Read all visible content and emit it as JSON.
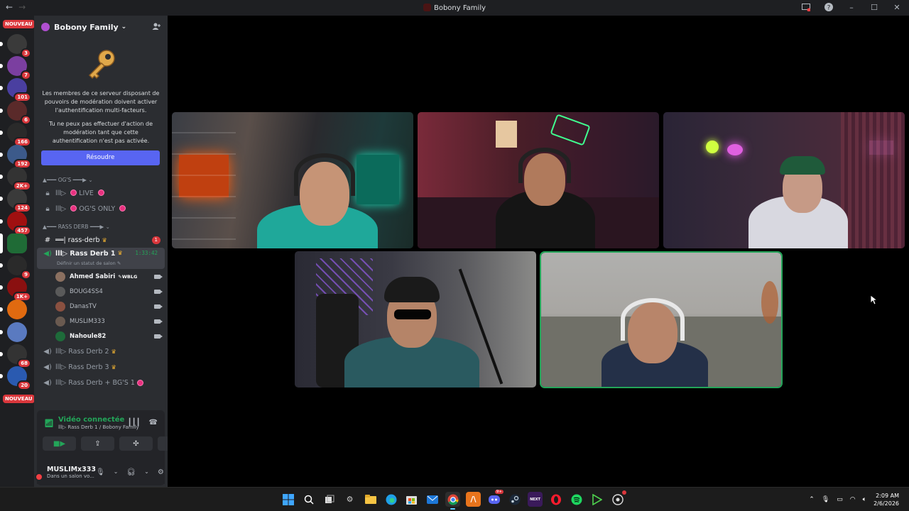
{
  "window": {
    "title": "Bobony Family"
  },
  "rail": {
    "nouveau_label": "NOUVEAU",
    "servers": [
      {
        "badge": "3",
        "color": "#3a3a3a"
      },
      {
        "badge": "7",
        "color": "#7b3fa0"
      },
      {
        "badge": "101",
        "color": "#4a3fa0"
      },
      {
        "badge": "6",
        "color": "#5a2a2a"
      },
      {
        "badge": "166",
        "color": "#2a2a2a"
      },
      {
        "badge": "192",
        "color": "#3c5a8a"
      },
      {
        "badge": "2K+",
        "color": "#333"
      },
      {
        "badge": "124",
        "color": "#3a3a3a"
      },
      {
        "badge": "457",
        "color": "#a01010"
      },
      {
        "badge": "",
        "color": "#1f6b36"
      },
      {
        "badge": "9",
        "color": "#2a2a2a"
      },
      {
        "badge": "1K+",
        "color": "#8a1010"
      },
      {
        "badge": "",
        "color": "#e06a10"
      },
      {
        "badge": "",
        "color": "#5a7ac0"
      },
      {
        "badge": "68",
        "color": "#333"
      },
      {
        "badge": "20",
        "color": "#2a5ab0"
      }
    ]
  },
  "sidebar": {
    "server_name": "Bobony Family",
    "notice_p1": "Les membres de ce serveur disposant de pouvoirs de modération doivent activer l'authentification multi-facteurs.",
    "notice_p2": "Tu ne peux pas effectuer d'action de modération tant que cette authentification n'est pas activée.",
    "resolve_label": "Résoudre",
    "cat1": "▲━━━ OG'S ━━━▶ ⌄",
    "live": "LIVE",
    "ogs_only": "OG'S ONLY",
    "cat2": "▲━━━ RASS DERB ━━━▶ ⌄",
    "rass_derb_text": "══| rass-derb",
    "rass_derb_mention": "1",
    "rd1": "Rass Derb 1",
    "rd1_timer": "1:33:42",
    "rd1_status": "Définir un statut de salon",
    "members": [
      {
        "name": "Ahmed Sabiri",
        "tag": "WBLG",
        "color": "#8b7060",
        "bold": true
      },
      {
        "name": "BOUG4SS4",
        "tag": "",
        "color": "#5a5a5a",
        "bold": false
      },
      {
        "name": "DanasTV",
        "tag": "",
        "color": "#8a5040",
        "bold": false
      },
      {
        "name": "MUSLIM333",
        "tag": "",
        "color": "#6a5a50",
        "bold": false
      },
      {
        "name": "Nahoule82",
        "tag": "",
        "color": "#1e6b3a",
        "bold": true
      }
    ],
    "rd2": "Rass Derb 2",
    "rd3": "Rass Derb 3",
    "rd_bgs": "Rass Derb + BG'S 1"
  },
  "voice": {
    "status": "Vidéo connectée",
    "sub": "Rass Derb 1 / Bobony Family"
  },
  "user": {
    "name": "MUSLIMx333",
    "status": "Dans un salon vo..."
  },
  "taskbar": {
    "time": "2:09 AM",
    "date": "2/6/2026"
  }
}
